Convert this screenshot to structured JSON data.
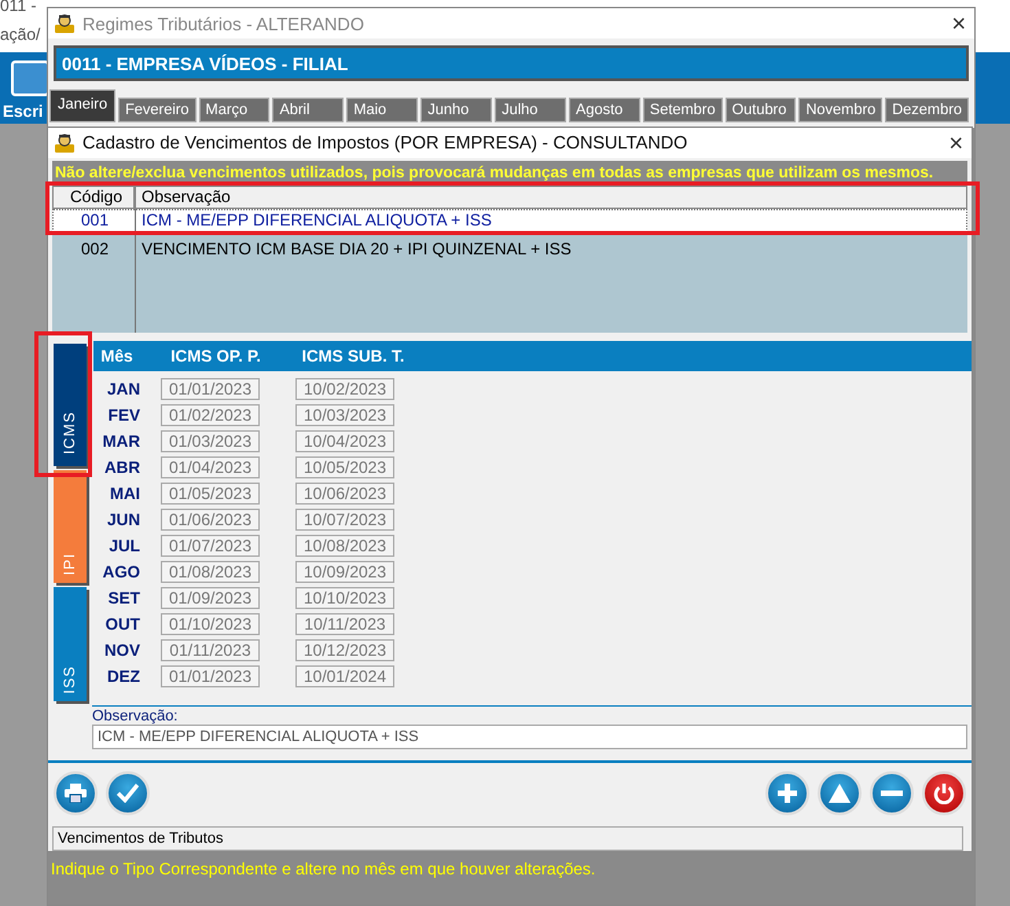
{
  "background_app": {
    "title_fragment": "011 -",
    "menu_fragment": "ação/",
    "toolbar_fragment": "Escri",
    "hint": "Indique o Tipo Correspondente e altere no mês em que houver alterações."
  },
  "outer_window": {
    "title": "Regimes Tributários  -  ALTERANDO",
    "close": "×",
    "company": "0011 - EMPRESA VÍDEOS - FILIAL",
    "months": [
      {
        "label": "Janeiro",
        "selected": true
      },
      {
        "label": "Fevereiro",
        "selected": false
      },
      {
        "label": "Março",
        "selected": false
      },
      {
        "label": "Abril",
        "selected": false
      },
      {
        "label": "Maio",
        "selected": false
      },
      {
        "label": "Junho",
        "selected": false
      },
      {
        "label": "Julho",
        "selected": false
      },
      {
        "label": "Agosto",
        "selected": false
      },
      {
        "label": "Setembro",
        "selected": false
      },
      {
        "label": "Outubro",
        "selected": false
      },
      {
        "label": "Novembro",
        "selected": false
      },
      {
        "label": "Dezembro",
        "selected": false
      }
    ]
  },
  "dialog": {
    "title": "Cadastro de Vencimentos de Impostos  (POR EMPRESA)  -  CONSULTANDO",
    "close": "×",
    "warning": "Não altere/exclua vencimentos utilizados, pois provocará mudanças em todas as empresas que utilizam os mesmos.",
    "table": {
      "columns": [
        "Código",
        "Observação"
      ],
      "rows": [
        {
          "code": "001",
          "observation": "ICM - ME/EPP DIFERENCIAL ALIQUOTA + ISS",
          "selected": true
        },
        {
          "code": "002",
          "observation": "VENCIMENTO ICM BASE DIA 20 + IPI QUINZENAL + ISS",
          "selected": false
        }
      ]
    },
    "tax_tabs": [
      {
        "label": "ICMS",
        "color": "#003f7d",
        "selected": true
      },
      {
        "label": "IPI",
        "color": "#f47c3c",
        "selected": false
      },
      {
        "label": "ISS",
        "color": "#0a7fc0",
        "selected": false
      }
    ],
    "schedule": {
      "columns": [
        "Mês",
        "ICMS OP. P.",
        "ICMS SUB. T."
      ],
      "rows": [
        {
          "month": "JAN",
          "op": "01/01/2023",
          "sub": "10/02/2023"
        },
        {
          "month": "FEV",
          "op": "01/02/2023",
          "sub": "10/03/2023"
        },
        {
          "month": "MAR",
          "op": "01/03/2023",
          "sub": "10/04/2023"
        },
        {
          "month": "ABR",
          "op": "01/04/2023",
          "sub": "10/05/2023"
        },
        {
          "month": "MAI",
          "op": "01/05/2023",
          "sub": "10/06/2023"
        },
        {
          "month": "JUN",
          "op": "01/06/2023",
          "sub": "10/07/2023"
        },
        {
          "month": "JUL",
          "op": "01/07/2023",
          "sub": "10/08/2023"
        },
        {
          "month": "AGO",
          "op": "01/08/2023",
          "sub": "10/09/2023"
        },
        {
          "month": "SET",
          "op": "01/09/2023",
          "sub": "10/10/2023"
        },
        {
          "month": "OUT",
          "op": "01/10/2023",
          "sub": "10/11/2023"
        },
        {
          "month": "NOV",
          "op": "01/11/2023",
          "sub": "10/12/2023"
        },
        {
          "month": "DEZ",
          "op": "01/01/2023",
          "sub": "10/01/2024"
        }
      ]
    },
    "observation": {
      "label": "Observação:",
      "value": "ICM - ME/EPP DIFERENCIAL ALIQUOTA + ISS"
    },
    "toolbar": {
      "left": [
        {
          "kind": "print"
        },
        {
          "kind": "confirm"
        }
      ],
      "right": [
        {
          "kind": "add"
        },
        {
          "kind": "up"
        },
        {
          "kind": "remove"
        },
        {
          "kind": "power"
        }
      ]
    },
    "status": "Vencimentos de Tributos"
  }
}
